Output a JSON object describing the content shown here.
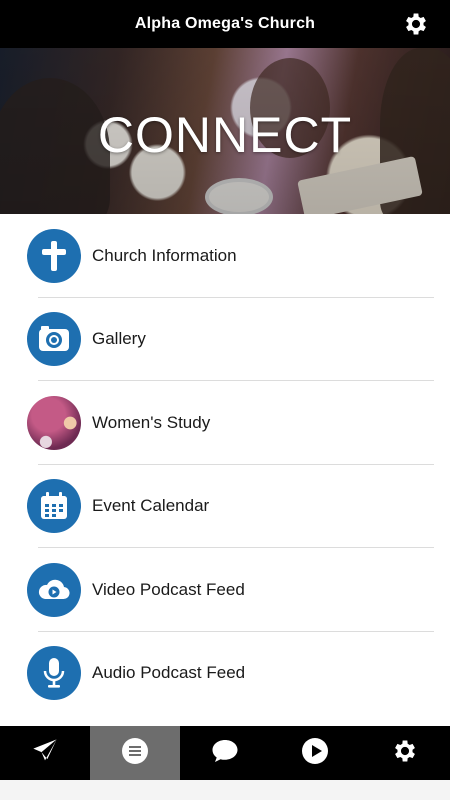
{
  "header": {
    "title": "Alpha Omega's Church",
    "settings_icon": "gear-icon"
  },
  "hero": {
    "label": "CONNECT"
  },
  "menu": {
    "items": [
      {
        "label": "Church Information",
        "icon": "cross-icon"
      },
      {
        "label": "Gallery",
        "icon": "camera-icon"
      },
      {
        "label": "Women's Study",
        "icon": "photo-thumbnail"
      },
      {
        "label": "Event Calendar",
        "icon": "calendar-icon"
      },
      {
        "label": "Video Podcast Feed",
        "icon": "cloud-play-icon"
      },
      {
        "label": "Audio Podcast Feed",
        "icon": "microphone-icon"
      }
    ]
  },
  "tabs": [
    {
      "icon": "send-icon",
      "active": false
    },
    {
      "icon": "list-icon",
      "active": true
    },
    {
      "icon": "chat-bubble-icon",
      "active": false
    },
    {
      "icon": "play-icon",
      "active": false
    },
    {
      "icon": "gear-icon",
      "active": false
    }
  ],
  "colors": {
    "accent": "#1e6fb0",
    "bar": "#000000",
    "active_tab": "#6d6d6d"
  }
}
